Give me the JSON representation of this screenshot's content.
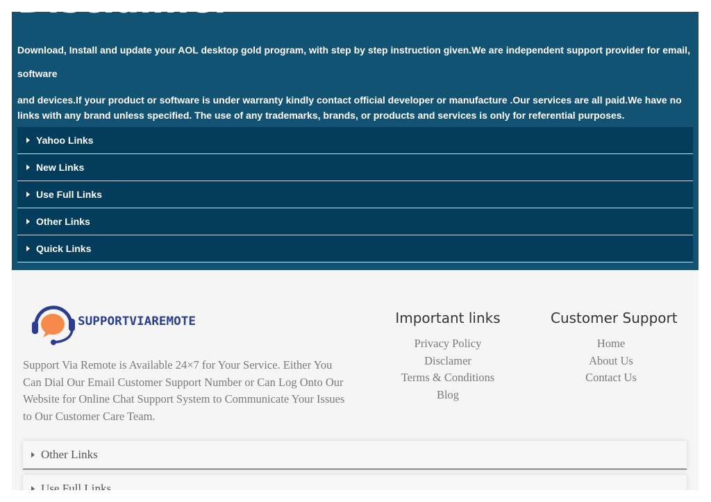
{
  "disclaimer": {
    "title": "Disclaimer",
    "text_line1": "Download, Install and update your AOL desktop gold program, with step by step instruction given.We are independent support provider for email, software",
    "text_line2": "and devices.If your product or software is under warranty kindly contact official developer or manufacture .Our services are all paid.We have no links with any brand unless specified. The use of any trademarks, brands, or products and services is only for referential purposes.",
    "accordion": [
      "Yahoo Links",
      "New Links",
      "Use Full Links",
      "Other Links",
      "Quick Links"
    ]
  },
  "footer": {
    "logo_text": "SUPPORTVIAREMOTE",
    "about_text": "Support Via Remote is Available 24×7 for Your Service. Either You Can Dial Our Email Customer Support Number or Can Log Onto Our Website for Online Chat Support System to Communicate Your Issues to Our Customer Care Team.",
    "important_links": {
      "heading": "Important links",
      "items": [
        "Privacy Policy",
        "Disclamer",
        "Terms & Conditions",
        "Blog"
      ]
    },
    "customer_support": {
      "heading": "Customer Support",
      "items": [
        "Home",
        "About Us",
        "Contact Us"
      ]
    },
    "accordion": [
      "Other Links",
      "Use Full Links"
    ]
  },
  "colors": {
    "disclaimer_bg": "#125272",
    "accordion_bg": "#033d5b",
    "logo_orange": "#f7894a",
    "logo_navy": "#2a3d8f"
  }
}
